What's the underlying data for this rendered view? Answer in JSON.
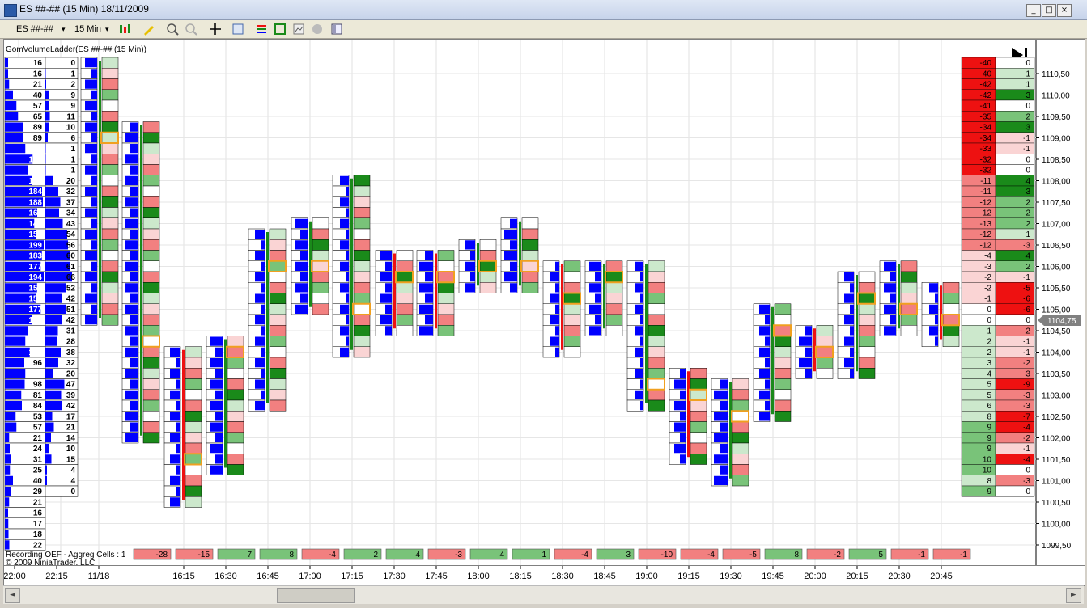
{
  "window": {
    "title": "ES ##-## (15 Min)  18/11/2009",
    "min_glyph": "_",
    "max_glyph": "□",
    "close_glyph": "×"
  },
  "toolbar": {
    "instrument": "ES ##-##",
    "interval": "15 Min",
    "dropdown_glyph": "▾"
  },
  "chart": {
    "indicator_label": "GomVolumeLadder(ES ##-## (15 Min))",
    "footer_line1": "Recording OEF - Aggreg Cells : 1",
    "footer_line2": "© 2009 NinjaTrader, LLC",
    "last_price_label": "1104,75",
    "colors": {
      "bid": "#0000ff",
      "pos_dark": "#1a8a1a",
      "pos_mid": "#79c379",
      "pos_light": "#cce8cc",
      "neg_dark": "#ee1111",
      "neg_mid": "#f28080",
      "neg_light": "#fad4d4",
      "poc_border": "#f0a020"
    },
    "price_axis": [
      "1110,50",
      "1110,00",
      "1109,50",
      "1109,00",
      "1108,50",
      "1108,00",
      "1107,50",
      "1107,00",
      "1106,50",
      "1106,00",
      "1105,50",
      "1105,00",
      "1104,50",
      "1104,00",
      "1103,50",
      "1103,00",
      "1102,50",
      "1102,00",
      "1101,50",
      "1101,00",
      "1100,50",
      "1100,00",
      "1099,50"
    ],
    "time_axis": [
      "22:00",
      "22:15",
      "11/18",
      "16:15",
      "16:30",
      "16:45",
      "17:00",
      "17:15",
      "17:30",
      "17:45",
      "18:00",
      "18:15",
      "18:30",
      "18:45",
      "19:00",
      "19:15",
      "19:30",
      "19:45",
      "20:00",
      "20:15",
      "20:30",
      "20:45"
    ],
    "left_profile_vol": [
      "16",
      "16",
      "21",
      "40",
      "57",
      "65",
      "89",
      "89",
      "101",
      "137",
      "113",
      "133",
      "184",
      "188",
      "160",
      "145",
      "154",
      "199",
      "183",
      "177",
      "194",
      "159",
      "152",
      "177",
      "134",
      "112",
      "101",
      "123",
      "96",
      "101",
      "98",
      "81",
      "84",
      "53",
      "57",
      "21",
      "24",
      "31",
      "25",
      "40",
      "29",
      "21",
      "16",
      "17",
      "18",
      "22"
    ],
    "left_profile_delta": [
      "0",
      "1",
      "2",
      "9",
      "9",
      "11",
      "10",
      "6",
      "1",
      "1",
      "1",
      "20",
      "32",
      "37",
      "34",
      "43",
      "54",
      "56",
      "60",
      "61",
      "66",
      "52",
      "42",
      "51",
      "42",
      "31",
      "28",
      "38",
      "32",
      "20",
      "47",
      "39",
      "42",
      "17",
      "21",
      "14",
      "10",
      "15",
      "4",
      "4",
      "0",
      "",
      "",
      "",
      "",
      ""
    ],
    "bar_deltas": [
      "-28",
      "-15",
      "7",
      "8",
      "-4",
      "2",
      "4",
      "-3",
      "4",
      "1",
      "-4",
      "3",
      "-10",
      "-4",
      "-5",
      "8",
      "-2",
      "5",
      "-1",
      "-1"
    ],
    "right_ladder_vol": [
      "-40",
      "-40",
      "-42",
      "-42",
      "-41",
      "-35",
      "-34",
      "-34",
      "-33",
      "-32",
      "-32",
      "-11",
      "-11",
      "-12",
      "-12",
      "-13",
      "-12",
      "-12",
      "-4",
      "-3",
      "-2",
      "-2",
      "-1",
      "0",
      "0",
      "1",
      "2",
      "2",
      "3",
      "4",
      "5",
      "5",
      "6",
      "8",
      "9",
      "9",
      "9",
      "10",
      "10",
      "8",
      "9"
    ],
    "right_ladder_delta": [
      "0",
      "1",
      "1",
      "3",
      "0",
      "2",
      "3",
      "-1",
      "-1",
      "0",
      "0",
      "4",
      "3",
      "2",
      "2",
      "2",
      "1",
      "-3",
      "4",
      "2",
      "-1",
      "-5",
      "-6",
      "-6",
      "0",
      "-2",
      "-1",
      "-1",
      "-2",
      "-3",
      "-9",
      "-3",
      "-3",
      "-7",
      "-4",
      "-2",
      "-1",
      "-4",
      "0",
      "-3",
      "0"
    ]
  }
}
